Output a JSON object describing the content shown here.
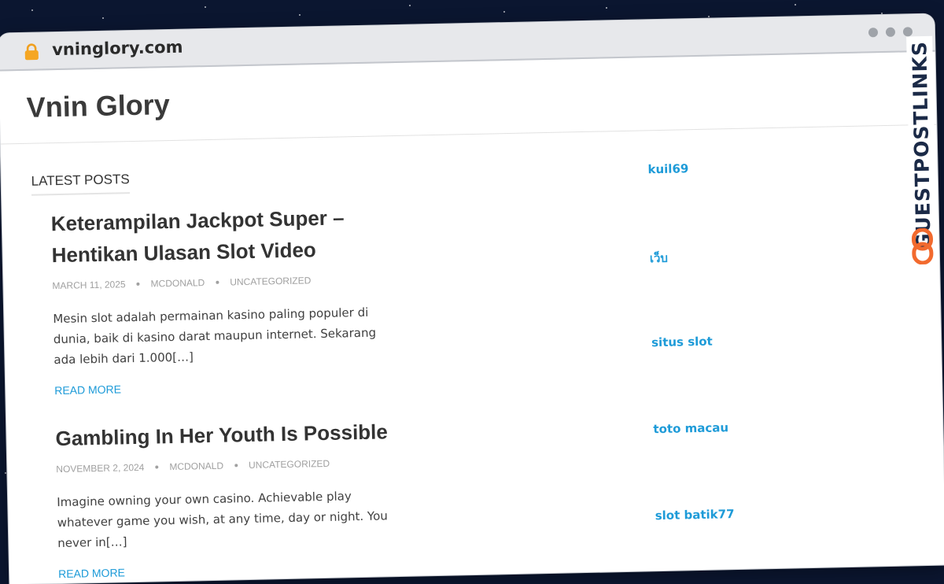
{
  "browser": {
    "url": "vninglory.com"
  },
  "site": {
    "title": "Vnin Glory"
  },
  "main": {
    "section_title": "LATEST POSTS",
    "posts": [
      {
        "title": "Keterampilan Jackpot Super – Hentikan Ulasan Slot Video",
        "date": "MARCH 11, 2025",
        "author": "MCDONALD",
        "category": "UNCATEGORIZED",
        "excerpt": "Mesin slot adalah permainan kasino paling populer di dunia, baik di kasino darat maupun internet. Sekarang ada lebih dari 1.000[…]",
        "read_more": "READ MORE"
      },
      {
        "title": "Gambling In Her Youth Is Possible",
        "date": "NOVEMBER 2, 2024",
        "author": "MCDONALD",
        "category": "UNCATEGORIZED",
        "excerpt": "Imagine owning your own casino. Achievable play whatever game you wish, at any time, day or night. You never in[…]",
        "read_more": "READ MORE"
      }
    ]
  },
  "sidebar": {
    "links": [
      "kuil69",
      "เว็บ",
      "situs slot",
      "toto macau",
      "slot batik77"
    ]
  },
  "badge": {
    "text": "GUESTPOSTLINKS"
  },
  "colors": {
    "link": "#1e9bd8",
    "badge_orange": "#f26a2e",
    "badge_navy": "#1b2a47"
  }
}
